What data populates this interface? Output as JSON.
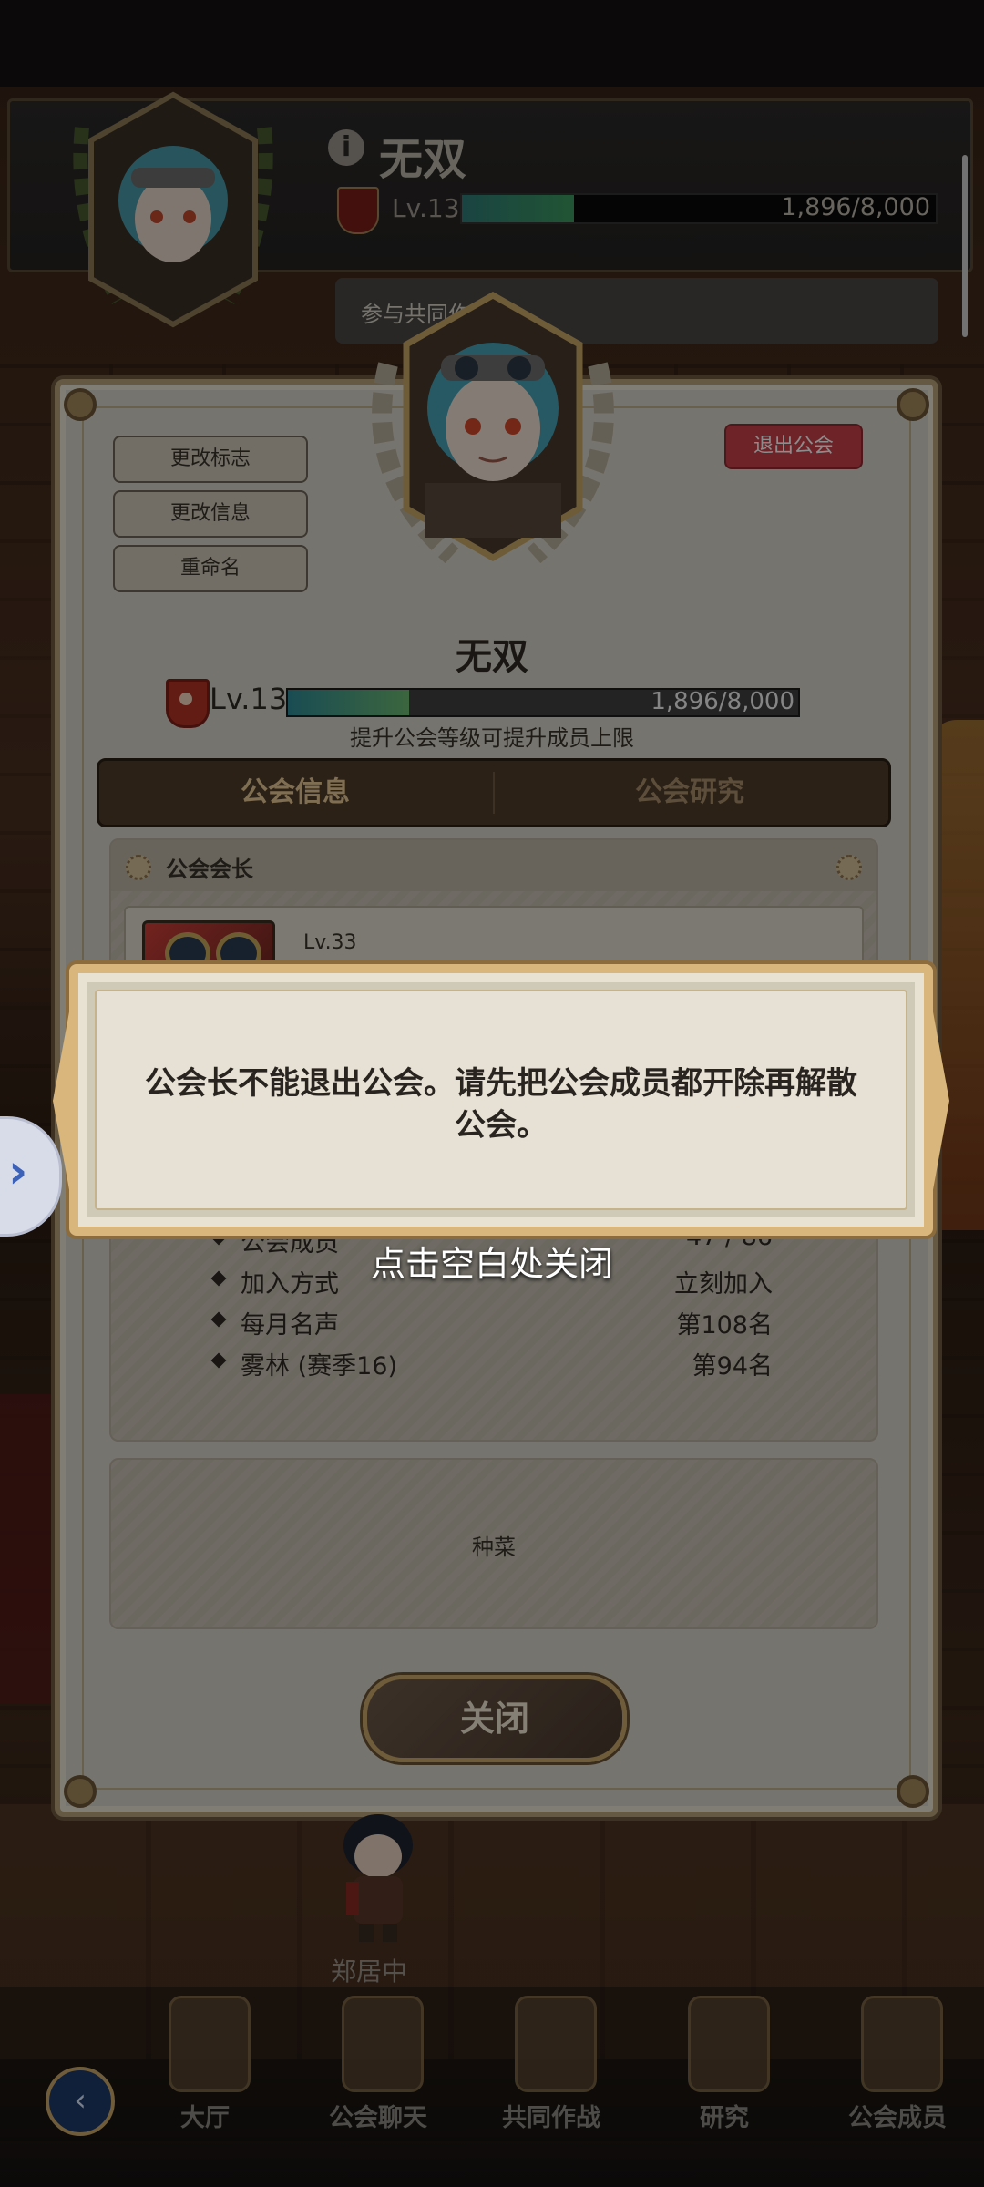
{
  "header": {
    "guild_name": "无双",
    "level": "Lv.13",
    "exp_text": "1,896/8,000",
    "exp_fraction": 0.237,
    "bubble_text": "参与共同作战"
  },
  "panel": {
    "buttons": {
      "change_emblem": "更改标志",
      "change_info": "更改信息",
      "rename": "重命名",
      "quit": "退出公会"
    },
    "guild_name": "无双",
    "level": "Lv.13",
    "exp_text": "1,896/8,000",
    "exp_fraction": 0.237,
    "hint": "提升公会等级可提升成员上限",
    "tabs": [
      {
        "label": "公会信息",
        "active": true
      },
      {
        "label": "公会研究",
        "active": false
      }
    ],
    "leader_section": {
      "title": "公会会长",
      "leader_level": "Lv.33"
    },
    "info_rows": [
      {
        "key": "公会成员",
        "value": "47 / 86"
      },
      {
        "key": "加入方式",
        "value": "立刻加入"
      },
      {
        "key": "每月名声",
        "value": "第108名"
      },
      {
        "key": "雾林 (赛季16)",
        "value": "第94名"
      }
    ],
    "notice": "种菜",
    "close_label": "关闭"
  },
  "toast": {
    "message": "公会长不能退出公会。请先把公会成员都开除再解散公会。",
    "dismiss_hint": "点击空白处关闭"
  },
  "npc_name": "郑居中",
  "bottom_nav": [
    {
      "label": "大厅",
      "icon": "shield-icon"
    },
    {
      "label": "公会聊天",
      "icon": "chat-icon"
    },
    {
      "label": "共同作战",
      "icon": "banner-icon"
    },
    {
      "label": "研究",
      "icon": "flask-icon"
    },
    {
      "label": "公会成员",
      "icon": "members-icon"
    }
  ],
  "colors": {
    "quit_button": "#c9404a",
    "tab_active": "#e8c896",
    "exp_fill": "#2f8c98"
  }
}
